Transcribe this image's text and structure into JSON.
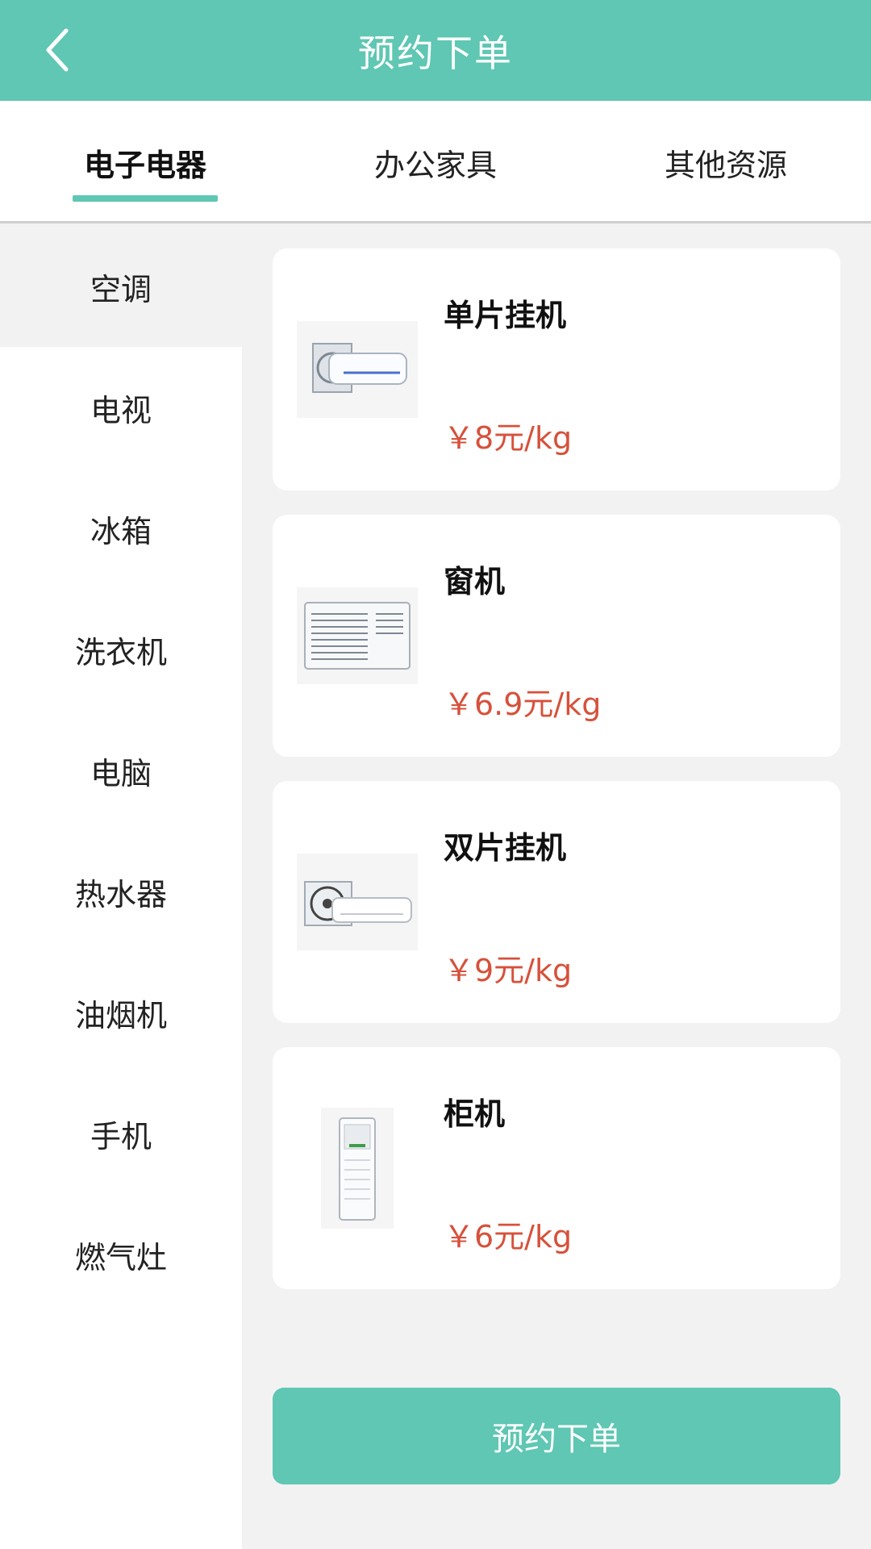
{
  "header": {
    "title": "预约下单",
    "back_icon": "chevron-left-icon"
  },
  "tabs": [
    {
      "label": "电子电器",
      "active": true
    },
    {
      "label": "办公家具",
      "active": false
    },
    {
      "label": "其他资源",
      "active": false
    }
  ],
  "sidebar": {
    "items": [
      {
        "label": "空调",
        "active": true
      },
      {
        "label": "电视"
      },
      {
        "label": "冰箱"
      },
      {
        "label": "洗衣机"
      },
      {
        "label": "电脑"
      },
      {
        "label": "热水器"
      },
      {
        "label": "油烟机"
      },
      {
        "label": "手机"
      },
      {
        "label": "燃气灶"
      }
    ]
  },
  "products": [
    {
      "name": "单片挂机",
      "price": "￥8元/kg",
      "image_icon": "split-wall-ac-icon"
    },
    {
      "name": "窗机",
      "price": "￥6.9元/kg",
      "image_icon": "window-ac-icon"
    },
    {
      "name": "双片挂机",
      "price": "￥9元/kg",
      "image_icon": "dual-split-ac-icon"
    },
    {
      "name": "柜机",
      "price": "￥6元/kg",
      "image_icon": "floor-standing-ac-icon"
    }
  ],
  "footer": {
    "submit_label": "预约下单"
  },
  "colors": {
    "primary": "#5fc7b3",
    "price": "#d6513b",
    "background": "#f2f2f2"
  }
}
